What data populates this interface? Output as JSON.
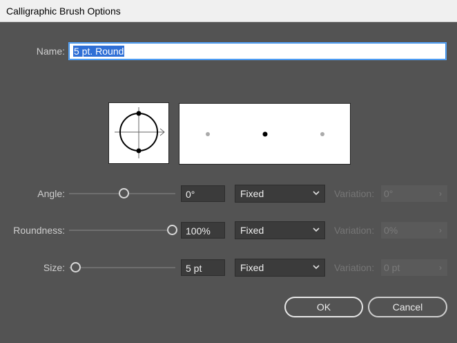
{
  "window": {
    "title": "Calligraphic Brush Options"
  },
  "name": {
    "label": "Name:",
    "value": "5 pt. Round"
  },
  "rows": [
    {
      "label": "Angle:",
      "value": "0°",
      "mode": "Fixed",
      "variation_label": "Variation:",
      "variation_value": "0°",
      "slider_fraction": 0.5
    },
    {
      "label": "Roundness:",
      "value": "100%",
      "mode": "Fixed",
      "variation_label": "Variation:",
      "variation_value": "0%",
      "slider_fraction": 1.0
    },
    {
      "label": "Size:",
      "value": "5 pt",
      "mode": "Fixed",
      "variation_label": "Variation:",
      "variation_value": "0 pt",
      "slider_fraction": 0.0
    }
  ],
  "buttons": {
    "ok": "OK",
    "cancel": "Cancel"
  }
}
